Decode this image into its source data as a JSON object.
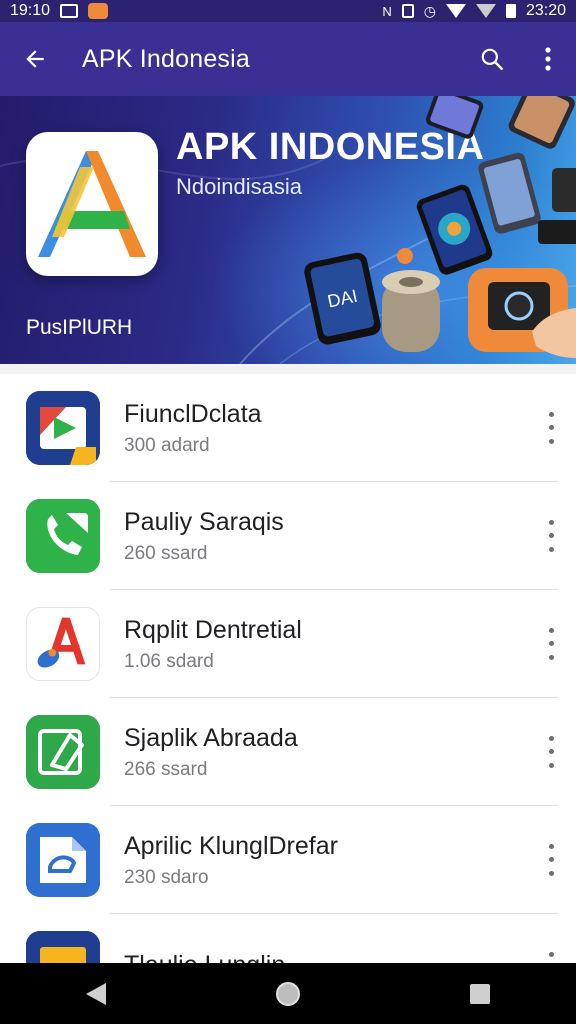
{
  "status_bar": {
    "time": "19:10",
    "clock_right": "23:20"
  },
  "app_bar": {
    "title": "APK Indonesia"
  },
  "banner": {
    "heading": "APK INDONESIA",
    "subheading": "Ndoindisasia",
    "footer": "PusIPlURH",
    "logo_letter": "A",
    "device_screen_text": "DAI"
  },
  "apps": [
    {
      "name": "FiunclDclata",
      "meta": "300 adard",
      "icon": "video-play-icon"
    },
    {
      "name": "Pauliy Saraqis",
      "meta": "260 ssard",
      "icon": "phone-icon"
    },
    {
      "name": "Rqplit Dentretial",
      "meta": "1.06 sdard",
      "icon": "letter-a-icon"
    },
    {
      "name": "Sjaplik Abraada",
      "meta": "266 ssard",
      "icon": "edit-square-icon"
    },
    {
      "name": "Aprilic KlunglDrefar",
      "meta": "230 sdaro",
      "icon": "document-icon"
    },
    {
      "name": "Tlaulie Lunglin",
      "meta": "",
      "icon": "folder-icon"
    }
  ],
  "colors": {
    "app_bar": "#3a2f93",
    "status_bar": "#2b2370",
    "accent_green": "#2fb24a",
    "accent_orange": "#f08a3b"
  }
}
